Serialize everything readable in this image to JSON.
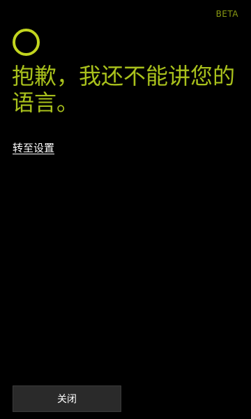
{
  "header": {
    "badge": "BETA"
  },
  "assistant": {
    "icon": "cortana-ring-icon",
    "message": "抱歉，我还不能讲您的语言。"
  },
  "links": {
    "settings_label": "转至设置"
  },
  "footer": {
    "close_label": "关闭"
  },
  "colors": {
    "background": "#000000",
    "accent": "#a9c11c",
    "ring": "#c2d51f",
    "badge": "#8a9a12",
    "button_bg": "#2a2a2a"
  }
}
